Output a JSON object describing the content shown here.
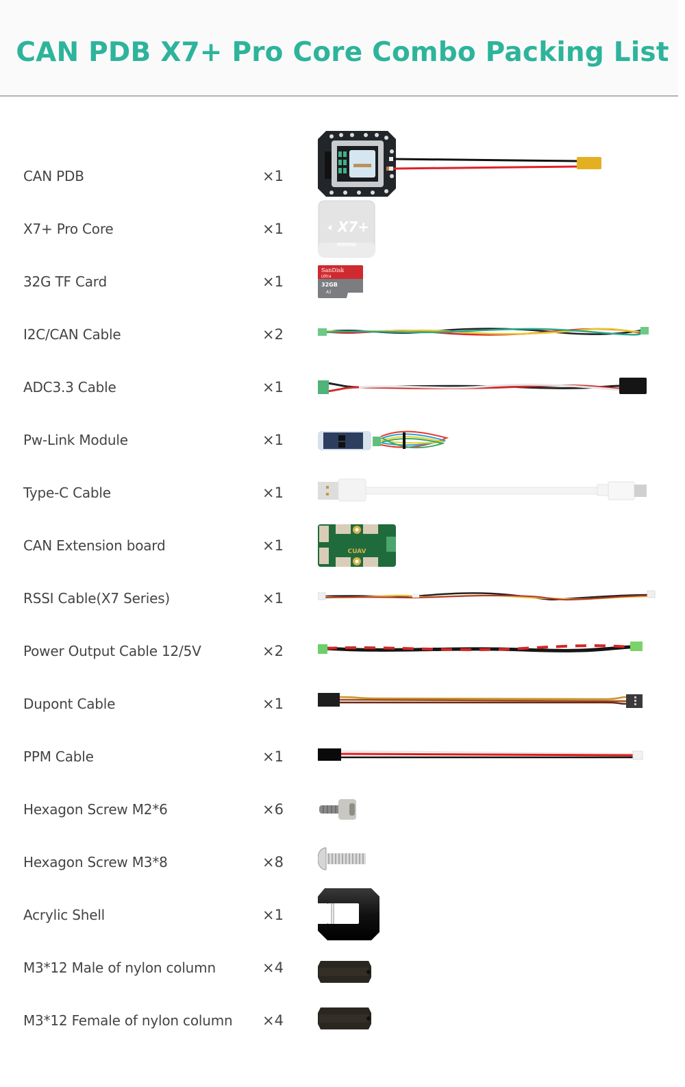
{
  "header": {
    "title": "CAN PDB X7+ Pro Core Combo Packing List"
  },
  "colors": {
    "title": "#2db49b",
    "text": "#444444",
    "header_bg": "#fafafa",
    "rule": "#b3b3b3"
  },
  "items": [
    {
      "name": "CAN PDB",
      "qty": "×1",
      "image": "pdb-board-with-xt-connector"
    },
    {
      "name": "X7+ Pro Core",
      "qty": "×1",
      "image": "x7-core-module",
      "image_text": "X7+"
    },
    {
      "name": "32G TF Card",
      "qty": "×1",
      "image": "sandisk-microsd-card",
      "image_text": [
        "SanDisk",
        "Ultra",
        "32GB",
        "A1"
      ]
    },
    {
      "name": "I2C/CAN Cable",
      "qty": "×2",
      "image": "twisted-4-wire-cable"
    },
    {
      "name": "ADC3.3 Cable",
      "qty": "×1",
      "image": "twisted-3-wire-cable"
    },
    {
      "name": "Pw-Link Module",
      "qty": "×1",
      "image": "pw-link-usb-module"
    },
    {
      "name": "Type-C Cable",
      "qty": "×1",
      "image": "usb-type-c-cable"
    },
    {
      "name": "CAN Extension board",
      "qty": "×1",
      "image": "can-hub-board",
      "image_text": "CUAV"
    },
    {
      "name": "RSSI Cable(X7 Series)",
      "qty": "×1",
      "image": "rssi-cable"
    },
    {
      "name": "Power Output Cable 12/5V",
      "qty": "×2",
      "image": "power-output-cable"
    },
    {
      "name": "Dupont Cable",
      "qty": "×1",
      "image": "dupont-cable"
    },
    {
      "name": "PPM Cable",
      "qty": "×1",
      "image": "ppm-cable"
    },
    {
      "name": "Hexagon Screw M2*6",
      "qty": "×6",
      "image": "hex-screw-m2"
    },
    {
      "name": "Hexagon Screw M3*8",
      "qty": "×8",
      "image": "button-screw-m3"
    },
    {
      "name": "Acrylic Shell",
      "qty": "×1",
      "image": "acrylic-shell"
    },
    {
      "name": "M3*12 Male of nylon column",
      "qty": "×4",
      "image": "nylon-standoff-male"
    },
    {
      "name": "M3*12 Female of nylon column",
      "qty": "×4",
      "image": "nylon-standoff-female"
    }
  ]
}
